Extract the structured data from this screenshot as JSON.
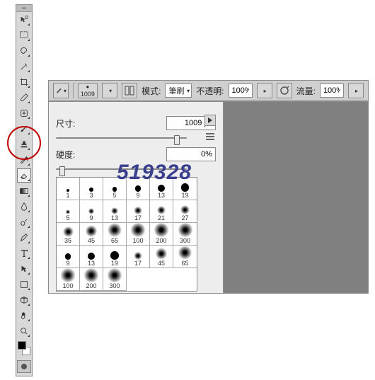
{
  "toolbox": {
    "tools": [
      {
        "name": "move",
        "icon": "move",
        "selected": false
      },
      {
        "name": "marquee",
        "icon": "marquee",
        "selected": false
      },
      {
        "name": "lasso",
        "icon": "lasso",
        "selected": false
      },
      {
        "name": "wand",
        "icon": "wand",
        "selected": false
      },
      {
        "name": "crop",
        "icon": "crop",
        "selected": false
      },
      {
        "name": "eyedropper",
        "icon": "eyedropper",
        "selected": false
      },
      {
        "name": "healing",
        "icon": "healing",
        "selected": false
      },
      {
        "name": "brush",
        "icon": "brush",
        "selected": false
      },
      {
        "name": "stamp",
        "icon": "stamp",
        "selected": false
      },
      {
        "name": "history-brush",
        "icon": "history",
        "selected": false
      },
      {
        "name": "eraser",
        "icon": "eraser",
        "selected": true
      },
      {
        "name": "gradient",
        "icon": "gradient",
        "selected": false
      },
      {
        "name": "blur",
        "icon": "blur",
        "selected": false
      },
      {
        "name": "dodge",
        "icon": "dodge",
        "selected": false
      },
      {
        "name": "pen",
        "icon": "pen",
        "selected": false
      },
      {
        "name": "type",
        "icon": "type",
        "selected": false
      },
      {
        "name": "path-select",
        "icon": "pathsel",
        "selected": false
      },
      {
        "name": "shape",
        "icon": "shape",
        "selected": false
      },
      {
        "name": "3d",
        "icon": "3d",
        "selected": false
      },
      {
        "name": "hand",
        "icon": "hand",
        "selected": false
      },
      {
        "name": "zoom",
        "icon": "zoom",
        "selected": false
      }
    ]
  },
  "options": {
    "brush_size_display": "1009",
    "mode_label": "模式:",
    "mode_value": "筆刷",
    "opacity_label": "不透明:",
    "opacity_value": "100%",
    "flow_label": "流量:",
    "flow_value": "100%"
  },
  "panel": {
    "size_label": "尺寸:",
    "size_value": "1009 px",
    "hardness_label": "硬度:",
    "hardness_value": "0%",
    "size_slider_pos": 0.95,
    "hard_slider_pos": 0.02,
    "presets": [
      {
        "size": 1,
        "soft": false
      },
      {
        "size": 3,
        "soft": false
      },
      {
        "size": 5,
        "soft": false
      },
      {
        "size": 9,
        "soft": false
      },
      {
        "size": 13,
        "soft": false
      },
      {
        "size": 19,
        "soft": false
      },
      {
        "size": 5,
        "soft": true
      },
      {
        "size": 9,
        "soft": true
      },
      {
        "size": 13,
        "soft": true
      },
      {
        "size": 17,
        "soft": true
      },
      {
        "size": 21,
        "soft": true
      },
      {
        "size": 27,
        "soft": true
      },
      {
        "size": 35,
        "soft": true
      },
      {
        "size": 45,
        "soft": true
      },
      {
        "size": 65,
        "soft": true
      },
      {
        "size": 100,
        "soft": true
      },
      {
        "size": 200,
        "soft": true
      },
      {
        "size": 300,
        "soft": true
      },
      {
        "size": 9,
        "soft": false
      },
      {
        "size": 13,
        "soft": false
      },
      {
        "size": 19,
        "soft": false
      },
      {
        "size": 17,
        "soft": true
      },
      {
        "size": 45,
        "soft": true
      },
      {
        "size": 65,
        "soft": true
      },
      {
        "size": 100,
        "soft": true
      },
      {
        "size": 200,
        "soft": true
      },
      {
        "size": 300,
        "soft": true
      }
    ]
  },
  "watermark": "519328"
}
